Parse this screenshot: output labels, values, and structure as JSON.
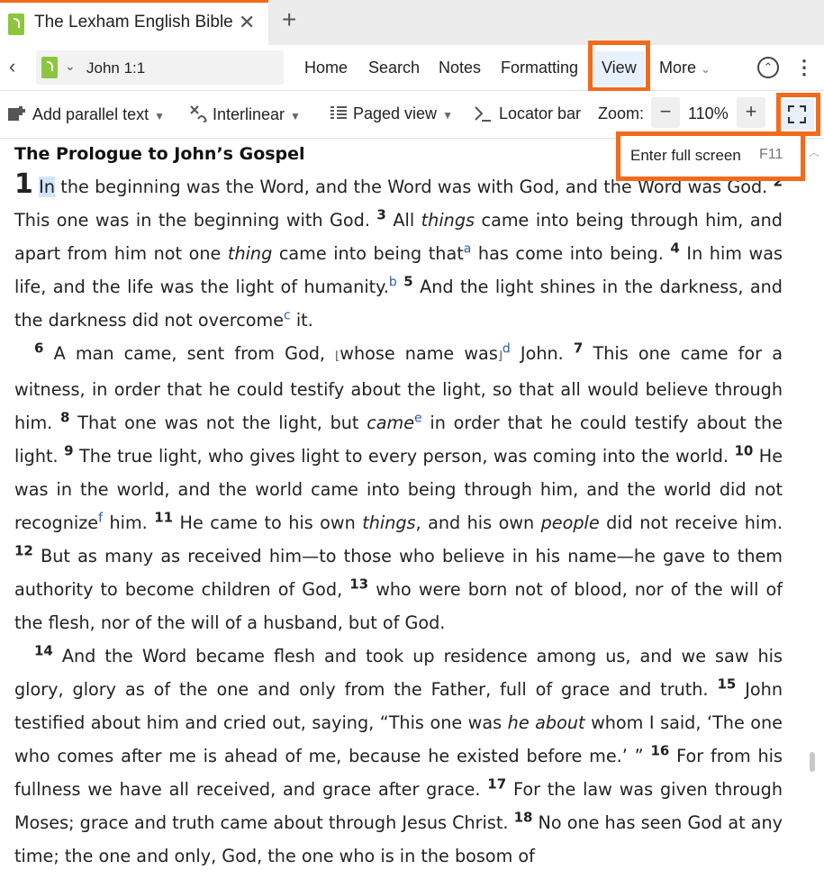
{
  "tab": {
    "title": "The Lexham English Bible",
    "close": "✕",
    "new": "+"
  },
  "nav": {
    "back": "‹",
    "reference": "John 1:1",
    "ref_chevron": "⌄",
    "items": [
      "Home",
      "Search",
      "Notes",
      "Formatting",
      "View",
      "More"
    ],
    "more_chevron": "⌄",
    "collapse": "⌃",
    "menu": "⋮"
  },
  "toolbar": {
    "parallel": "Add parallel text",
    "interlinear": "Interlinear",
    "paged": "Paged view",
    "locator": "Locator bar",
    "zoom_label": "Zoom:",
    "zoom_minus": "−",
    "zoom_value": "110%",
    "zoom_plus": "+"
  },
  "tooltip": {
    "label": "Enter full screen",
    "key": "F11"
  },
  "colors": {
    "accent": "#f26b1d",
    "highlight": "#cfe6fb",
    "icon_green": "#8cc63f",
    "footnote": "#2a5db0"
  },
  "text": {
    "heading": "The Prologue to John’s Gospel",
    "chapter": "1",
    "w_in": "In",
    "p1_a": " the beginning was the Word, and the Word was with God, and the Word was God. ",
    "v2": "2",
    "p1_b": " This one was in the beginning with God. ",
    "v3": "3",
    "p1_c": " All ",
    "things": "things",
    "p1_d": " came into being through him, and apart from him not one ",
    "thing": "thing",
    "p1_e": " came into being that",
    "fn_a": "a",
    "p1_f": " has come into being. ",
    "v4": "4",
    "p1_g": " In him was life, and the life was the light of humanity.",
    "fn_b": "b",
    "v5": "5",
    "p1_h": " And the light shines in the darkness, and the darkness did not overcome",
    "fn_c": "c",
    "p1_i": " it.",
    "v6": "6",
    "p2_a": " A man came, sent from God, ",
    "br_open": "⌊",
    "p2_b": "whose name was",
    "br_close": "⌋",
    "fn_d": "d",
    "p2_c": " John. ",
    "v7": "7",
    "p2_d": " This one came for a witness, in order that he could testify about the light, so that all would believe through him. ",
    "v8": "8",
    "p2_e": " That one was not the light, but ",
    "came": "came",
    "fn_e": "e",
    "p2_f": " in order that he could testify about the light. ",
    "v9": "9",
    "p2_g": " The true light, who gives light to every person, was coming into the world. ",
    "v10": "10",
    "p2_h": " He was in the world, and the world came into being through him, and the world did not recognize",
    "fn_f": "f",
    "p2_i": " him. ",
    "v11": "11",
    "p2_j": " He came to his own ",
    "things2": "things",
    "p2_k": ", and his own ",
    "people": "people",
    "p2_l": " did not receive him. ",
    "v12": "12",
    "p2_m": " But as many as received him—to those who believe in his name—he gave to them authority to become children of God, ",
    "v13": "13",
    "p2_n": " who were born not of blood, nor of the will of the flesh, nor of the will of a husband, but of God.",
    "v14": "14",
    "p3_a": " And the Word became flesh and took up residence among us, and we saw his glory, glory as of the one and only from the Father, full of grace and truth. ",
    "v15": "15",
    "p3_b": " John testified about him and cried out, saying, “This one was ",
    "he_about": "he about",
    "p3_c": " whom I said, ‘The one who comes after me is ahead of me, because he existed before me.’ ” ",
    "v16": "16",
    "p3_d": " For from his fullness we have all received, and grace after grace. ",
    "v17": "17",
    "p3_e": " For the law was given through Moses; grace and truth came about through Jesus Christ. ",
    "v18": "18",
    "p3_f": " No one has seen God at any time; the one and only, God, the one who is in the bosom of"
  }
}
